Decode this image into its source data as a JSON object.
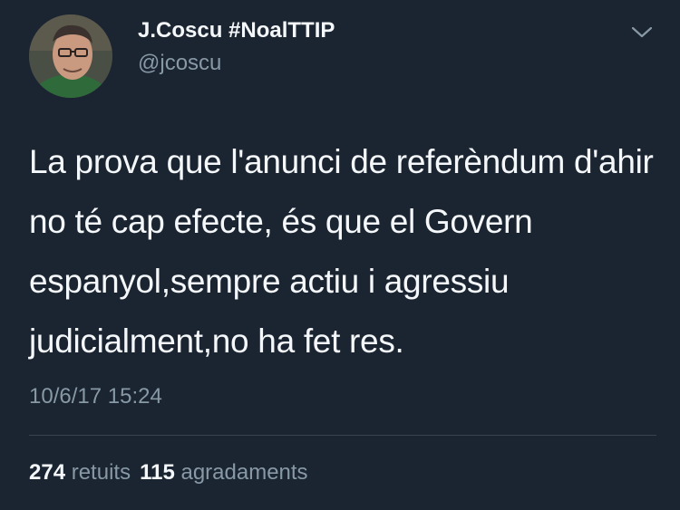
{
  "tweet": {
    "author": {
      "display_name": "J.Coscu #NoalTTIP",
      "handle": "@jcoscu"
    },
    "menu_icon": "chevron-down-icon",
    "text": "La prova que l'anunci de referèndum d'ahir no té cap efecte, és que el Govern espanyol,sempre actiu i agressiu judicialment,no ha fet res.",
    "timestamp": "10/6/17 15:24",
    "stats": {
      "retweets": {
        "count": "274",
        "label": "retuits"
      },
      "likes": {
        "count": "115",
        "label": "agradaments"
      }
    }
  },
  "colors": {
    "background": "#1b2431",
    "primary_text": "#f5f8fa",
    "secondary_text": "#8899a6",
    "divider": "#38444d"
  }
}
